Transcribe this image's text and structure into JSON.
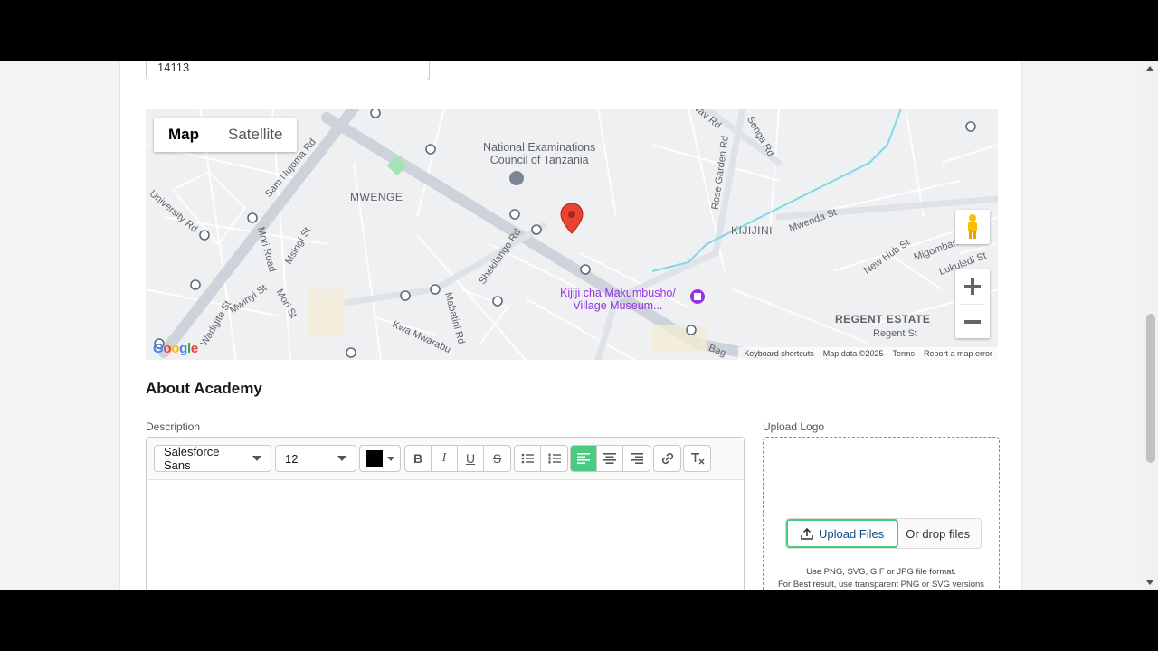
{
  "form": {
    "code_value": "14113"
  },
  "map": {
    "type_map": "Map",
    "type_satellite": "Satellite",
    "labels": {
      "national_exam_1": "National Examinations",
      "national_exam_2": "Council of Tanzania",
      "mwenge": "MWENGE",
      "kijijini": "KIJIJINI",
      "regent_estate": "REGENT ESTATE",
      "museum_1": "Kijiji cha Makumbusho/",
      "museum_2": "Village Museum...",
      "sam_nujoma": "Sam Nujoma Rd",
      "university": "University Rd",
      "mori_road": "Mori Road",
      "msingi_st": "Msingi St",
      "mwinyi": "Mwinyi St",
      "mori_st": "Mori St",
      "shekilango": "Shekilango Rd",
      "mabatini": "Mabatini Rd",
      "kwa_mwarabu": "Kwa Mwarabu",
      "rose_garden": "Rose Garden Rd",
      "senga": "Senga Rd",
      "mwenda": "Mwenda St",
      "new_hub": "New Hub St",
      "migombani": "Migombani",
      "lukuledi": "Lukuledi St",
      "regent_st": "Regent St",
      "way_rd": "Way Rd",
      "bag": "Bag",
      "wadigite": "Wadigite St"
    },
    "attribution": {
      "shortcuts": "Keyboard shortcuts",
      "data": "Map data ©2025",
      "terms": "Terms",
      "report": "Report a map error"
    },
    "google": [
      "G",
      "o",
      "o",
      "g",
      "l",
      "e"
    ]
  },
  "about": {
    "title": "About Academy",
    "description_label": "Description",
    "font_family": "Salesforce Sans",
    "font_size": "12",
    "text_color": "#000000"
  },
  "upload": {
    "label": "Upload Logo",
    "button": "Upload Files",
    "drop": "Or drop files",
    "hint1": "Use PNG, SVG, GIF or JPG file format.",
    "hint2": "For Best result, use transparent PNG or SVG versions"
  },
  "colors": {
    "accent_green": "#4bca81",
    "pin_red": "#ea4335"
  }
}
